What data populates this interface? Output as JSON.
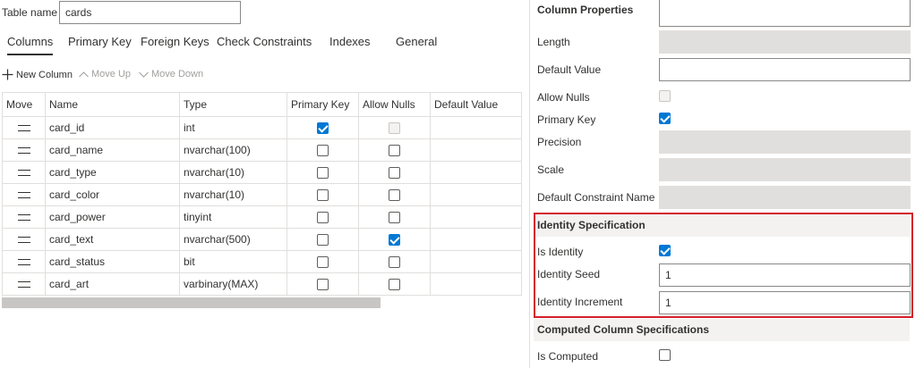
{
  "table_name": {
    "label": "Table name",
    "value": "cards"
  },
  "tabs": [
    {
      "label": "Columns",
      "active": true
    },
    {
      "label": "Primary Key",
      "active": false
    },
    {
      "label": "Foreign Keys",
      "active": false
    },
    {
      "label": "Check Constraints",
      "active": false
    },
    {
      "label": "Indexes",
      "active": false
    },
    {
      "label": "General",
      "active": false
    }
  ],
  "toolbar": {
    "new_column": "New Column",
    "move_up": "Move Up",
    "move_down": "Move Down"
  },
  "grid": {
    "headers": [
      "Move",
      "Name",
      "Type",
      "Primary Key",
      "Allow Nulls",
      "Default Value"
    ],
    "rows": [
      {
        "name": "card_id",
        "type": "int",
        "primary_key": true,
        "allow_nulls": false,
        "allow_nulls_disabled": true,
        "default": ""
      },
      {
        "name": "card_name",
        "type": "nvarchar(100)",
        "primary_key": false,
        "allow_nulls": false,
        "allow_nulls_disabled": false,
        "default": ""
      },
      {
        "name": "card_type",
        "type": "nvarchar(10)",
        "primary_key": false,
        "allow_nulls": false,
        "allow_nulls_disabled": false,
        "default": ""
      },
      {
        "name": "card_color",
        "type": "nvarchar(10)",
        "primary_key": false,
        "allow_nulls": false,
        "allow_nulls_disabled": false,
        "default": ""
      },
      {
        "name": "card_power",
        "type": "tinyint",
        "primary_key": false,
        "allow_nulls": false,
        "allow_nulls_disabled": false,
        "default": ""
      },
      {
        "name": "card_text",
        "type": "nvarchar(500)",
        "primary_key": false,
        "allow_nulls": true,
        "allow_nulls_disabled": false,
        "default": ""
      },
      {
        "name": "card_status",
        "type": "bit",
        "primary_key": false,
        "allow_nulls": false,
        "allow_nulls_disabled": false,
        "default": ""
      },
      {
        "name": "card_art",
        "type": "varbinary(MAX)",
        "primary_key": false,
        "allow_nulls": false,
        "allow_nulls_disabled": false,
        "default": ""
      }
    ]
  },
  "properties": {
    "title": "Column Properties",
    "length_label": "Length",
    "default_value_label": "Default Value",
    "default_value": "",
    "allow_nulls_label": "Allow Nulls",
    "allow_nulls_checked": false,
    "primary_key_label": "Primary Key",
    "primary_key_checked": true,
    "precision_label": "Precision",
    "scale_label": "Scale",
    "default_constraint_label": "Default Constraint Name",
    "identity_title": "Identity Specification",
    "is_identity_label": "Is Identity",
    "is_identity_checked": true,
    "identity_seed_label": "Identity Seed",
    "identity_seed": "1",
    "identity_increment_label": "Identity Increment",
    "identity_increment": "1",
    "computed_title": "Computed Column Specifications",
    "is_computed_label": "Is Computed",
    "is_computed_checked": false
  },
  "colors": {
    "accent": "#0078d4",
    "highlight_border": "#d4202a",
    "disabled_field": "#e1dfdd",
    "section_bg": "#f3f2f1"
  },
  "icons": [
    "plus-icon",
    "chevron-up-icon",
    "chevron-down-icon",
    "drag-handle-icon",
    "checkmark-icon"
  ]
}
